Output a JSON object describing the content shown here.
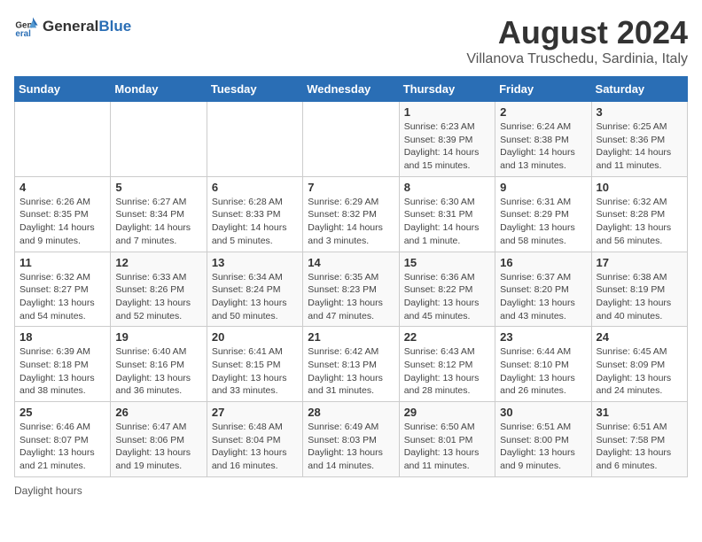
{
  "header": {
    "logo_general": "General",
    "logo_blue": "Blue",
    "title": "August 2024",
    "subtitle": "Villanova Truschedu, Sardinia, Italy"
  },
  "days_of_week": [
    "Sunday",
    "Monday",
    "Tuesday",
    "Wednesday",
    "Thursday",
    "Friday",
    "Saturday"
  ],
  "weeks": [
    [
      {
        "day": "",
        "info": ""
      },
      {
        "day": "",
        "info": ""
      },
      {
        "day": "",
        "info": ""
      },
      {
        "day": "",
        "info": ""
      },
      {
        "day": "1",
        "info": "Sunrise: 6:23 AM\nSunset: 8:39 PM\nDaylight: 14 hours and 15 minutes."
      },
      {
        "day": "2",
        "info": "Sunrise: 6:24 AM\nSunset: 8:38 PM\nDaylight: 14 hours and 13 minutes."
      },
      {
        "day": "3",
        "info": "Sunrise: 6:25 AM\nSunset: 8:36 PM\nDaylight: 14 hours and 11 minutes."
      }
    ],
    [
      {
        "day": "4",
        "info": "Sunrise: 6:26 AM\nSunset: 8:35 PM\nDaylight: 14 hours and 9 minutes."
      },
      {
        "day": "5",
        "info": "Sunrise: 6:27 AM\nSunset: 8:34 PM\nDaylight: 14 hours and 7 minutes."
      },
      {
        "day": "6",
        "info": "Sunrise: 6:28 AM\nSunset: 8:33 PM\nDaylight: 14 hours and 5 minutes."
      },
      {
        "day": "7",
        "info": "Sunrise: 6:29 AM\nSunset: 8:32 PM\nDaylight: 14 hours and 3 minutes."
      },
      {
        "day": "8",
        "info": "Sunrise: 6:30 AM\nSunset: 8:31 PM\nDaylight: 14 hours and 1 minute."
      },
      {
        "day": "9",
        "info": "Sunrise: 6:31 AM\nSunset: 8:29 PM\nDaylight: 13 hours and 58 minutes."
      },
      {
        "day": "10",
        "info": "Sunrise: 6:32 AM\nSunset: 8:28 PM\nDaylight: 13 hours and 56 minutes."
      }
    ],
    [
      {
        "day": "11",
        "info": "Sunrise: 6:32 AM\nSunset: 8:27 PM\nDaylight: 13 hours and 54 minutes."
      },
      {
        "day": "12",
        "info": "Sunrise: 6:33 AM\nSunset: 8:26 PM\nDaylight: 13 hours and 52 minutes."
      },
      {
        "day": "13",
        "info": "Sunrise: 6:34 AM\nSunset: 8:24 PM\nDaylight: 13 hours and 50 minutes."
      },
      {
        "day": "14",
        "info": "Sunrise: 6:35 AM\nSunset: 8:23 PM\nDaylight: 13 hours and 47 minutes."
      },
      {
        "day": "15",
        "info": "Sunrise: 6:36 AM\nSunset: 8:22 PM\nDaylight: 13 hours and 45 minutes."
      },
      {
        "day": "16",
        "info": "Sunrise: 6:37 AM\nSunset: 8:20 PM\nDaylight: 13 hours and 43 minutes."
      },
      {
        "day": "17",
        "info": "Sunrise: 6:38 AM\nSunset: 8:19 PM\nDaylight: 13 hours and 40 minutes."
      }
    ],
    [
      {
        "day": "18",
        "info": "Sunrise: 6:39 AM\nSunset: 8:18 PM\nDaylight: 13 hours and 38 minutes."
      },
      {
        "day": "19",
        "info": "Sunrise: 6:40 AM\nSunset: 8:16 PM\nDaylight: 13 hours and 36 minutes."
      },
      {
        "day": "20",
        "info": "Sunrise: 6:41 AM\nSunset: 8:15 PM\nDaylight: 13 hours and 33 minutes."
      },
      {
        "day": "21",
        "info": "Sunrise: 6:42 AM\nSunset: 8:13 PM\nDaylight: 13 hours and 31 minutes."
      },
      {
        "day": "22",
        "info": "Sunrise: 6:43 AM\nSunset: 8:12 PM\nDaylight: 13 hours and 28 minutes."
      },
      {
        "day": "23",
        "info": "Sunrise: 6:44 AM\nSunset: 8:10 PM\nDaylight: 13 hours and 26 minutes."
      },
      {
        "day": "24",
        "info": "Sunrise: 6:45 AM\nSunset: 8:09 PM\nDaylight: 13 hours and 24 minutes."
      }
    ],
    [
      {
        "day": "25",
        "info": "Sunrise: 6:46 AM\nSunset: 8:07 PM\nDaylight: 13 hours and 21 minutes."
      },
      {
        "day": "26",
        "info": "Sunrise: 6:47 AM\nSunset: 8:06 PM\nDaylight: 13 hours and 19 minutes."
      },
      {
        "day": "27",
        "info": "Sunrise: 6:48 AM\nSunset: 8:04 PM\nDaylight: 13 hours and 16 minutes."
      },
      {
        "day": "28",
        "info": "Sunrise: 6:49 AM\nSunset: 8:03 PM\nDaylight: 13 hours and 14 minutes."
      },
      {
        "day": "29",
        "info": "Sunrise: 6:50 AM\nSunset: 8:01 PM\nDaylight: 13 hours and 11 minutes."
      },
      {
        "day": "30",
        "info": "Sunrise: 6:51 AM\nSunset: 8:00 PM\nDaylight: 13 hours and 9 minutes."
      },
      {
        "day": "31",
        "info": "Sunrise: 6:51 AM\nSunset: 7:58 PM\nDaylight: 13 hours and 6 minutes."
      }
    ]
  ],
  "footnote": "Daylight hours"
}
